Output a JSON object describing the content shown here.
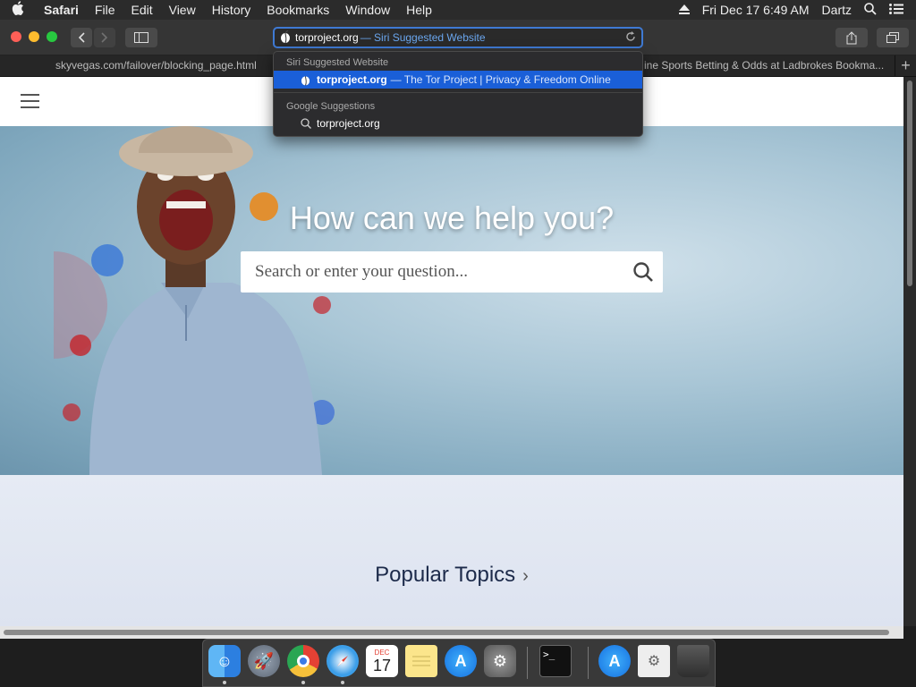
{
  "menubar": {
    "app_name": "Safari",
    "menus": [
      "File",
      "Edit",
      "View",
      "History",
      "Bookmarks",
      "Window",
      "Help"
    ],
    "datetime": "Fri Dec 17  6:49 AM",
    "user": "Dartz",
    "icons": [
      "apple-icon",
      "eject-icon",
      "search-icon",
      "list-icon"
    ]
  },
  "toolbar": {
    "url_text": "torproject.org",
    "url_hint": "— Siri Suggested Website"
  },
  "tabs": [
    {
      "title": "skyvegas.com/failover/blocking_page.html"
    },
    {
      "title": "ine Sports Betting & Odds at Ladbrokes Bookma..."
    }
  ],
  "dropdown": {
    "section1_header": "Siri Suggested Website",
    "suggestion1_url": "torproject.org",
    "suggestion1_title": "— The Tor Project | Privacy & Freedom Online",
    "section2_header": "Google Suggestions",
    "suggestion2_text": "torproject.org"
  },
  "page": {
    "hero_title": "How can we help you?",
    "search_placeholder": "Search or enter your question...",
    "popular_topics": "Popular Topics"
  },
  "dock": {
    "apps": [
      "Finder",
      "Launchpad",
      "Chrome",
      "Safari",
      "Calendar",
      "Notes",
      "App Store",
      "System Preferences",
      "Terminal",
      "App Store",
      "Config",
      "Trash"
    ],
    "calendar_day": "17",
    "calendar_month": "DEC"
  },
  "colors": {
    "accent": "#1a5fd8",
    "menubar": "#2b2b2b",
    "hero": "#a9c6d6"
  }
}
